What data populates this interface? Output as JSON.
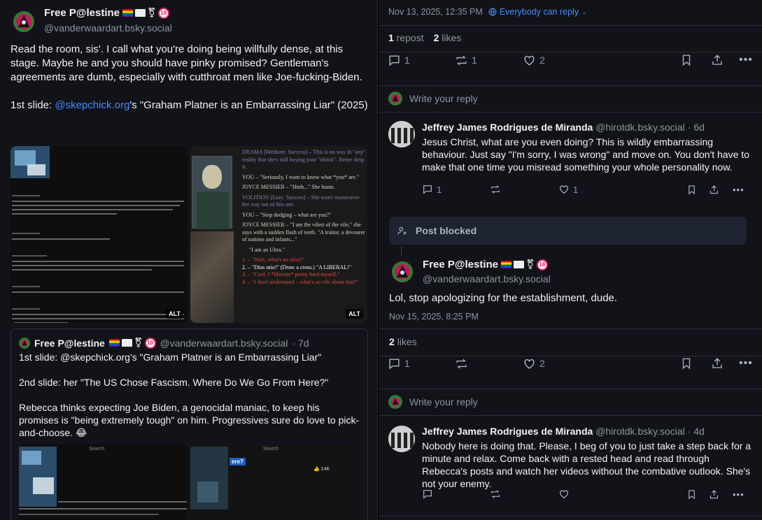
{
  "left": {
    "post": {
      "name": "Free P@lestine",
      "handle": "@vanderwaardart.bsky.social",
      "text_p1": "Read the room, sis'. I call what you're doing being willfully dense, at this stage. Maybe he and you should have pinky promised? Gentleman's agreements are dumb, especially with cutthroat men like Joe-fucking-Biden.",
      "text_p2_prefix": "1st slide: ",
      "text_p2_link": "@skepchick.org",
      "text_p2_suffix": "'s \"Graham Platner is an Embarrassing Liar\" (2025)",
      "alt_label": "ALT"
    },
    "game_text": {
      "line1": "DRAMA [Medium: Success] – This is no way in \"any\" reality that she's still buying your \"shtick\". Better drop it.",
      "line2": "YOU – \"Seriously, I want to know what *you* are.\"",
      "line3": "JOYCE MESSIER – \"Hmh...\" She hums.",
      "line4": "VOLITION [Easy: Success] – She won't manoeuvre her way out of this one.",
      "line5": "YOU – \"Stop dodging – what are you?\"",
      "line6": "JOYCE MESSIER – \"I am the vilest of the vile,\" she says with a sudden flash of teeth. \"A traitor, a devourer of nations and infants...\"",
      "line7": "\"I am an Ultra.\"",
      "opt1": "1. – \"Wait, what's an ultra?\"",
      "opt2": "2. – \"Dios mio!\" (Draw a cross.) \"A LIBERAL!\"",
      "opt3": "3. – \"Cool. I *liberate* pretty hard myself.\"",
      "opt4": "4. – \"I don't understand – what's so vile about that?\""
    },
    "quote": {
      "name": "Free P@lestine",
      "handle": "@vanderwaardart.bsky.social",
      "time": "· 7d",
      "p1": "1st slide:  @skepchick.org's \"Graham Platner is an Embarrassing Liar\"",
      "p2": "2nd slide: her \"The US Chose Fascism. Where Do We Go From Here?\"",
      "p3": "Rebecca thinks expecting Joe Biden, a genocidal maniac, to keep his promises is \"being extremely tough\" on him. Progressives sure do love to pick-and-choose. 😂",
      "thumb_search": "Search",
      "thumb_search2": "Search",
      "thumb_title": "ere?",
      "thumb_likes": "14K"
    }
  },
  "right": {
    "meta": {
      "timestamp": "Nov 13, 2025, 12:35 PM",
      "audience": "Everybody can reply",
      "reposts_count": "1",
      "reposts_label": "repost",
      "likes_count": "2",
      "likes_label": "likes"
    },
    "main_actions": {
      "reply": "1",
      "repost": "1",
      "like": "2"
    },
    "write_reply_1": "Write your reply",
    "reply1": {
      "name": "Jeffrey James Rodrigues de Miranda",
      "handle": "@hirotdk.bsky.social",
      "time": "· 6d",
      "text": "Jesus Christ, what are you even doing? This is wildly embarrassing behaviour. Just say \"I'm sorry, I was wrong\" and move on. You don't have to make that one time you misread something your whole personality now.",
      "reply_count": "1",
      "like_count": "1"
    },
    "blocked": "Post blocked",
    "post2": {
      "name": "Free P@lestine",
      "handle": "@vanderwaardart.bsky.social",
      "text": "Lol, stop apologizing for the establishment, dude.",
      "timestamp": "Nov 15, 2025, 8:25 PM",
      "likes_count": "2",
      "likes_label": "likes",
      "reply": "1",
      "like": "2"
    },
    "write_reply_2": "Write your reply",
    "reply2": {
      "name": "Jeffrey James Rodrigues de Miranda",
      "handle": "@hirotdk.bsky.social",
      "time": "· 4d",
      "text": "Nobody here is doing that. Please, I beg of you to just take a step back for a minute and relax. Come back with a rested head and read through Rebecca's posts and watch her videos without the combative outlook. She's not your enemy."
    }
  },
  "colors": {
    "accent": "#3f8cff",
    "bg": "#121318",
    "muted": "#8c94a1"
  }
}
